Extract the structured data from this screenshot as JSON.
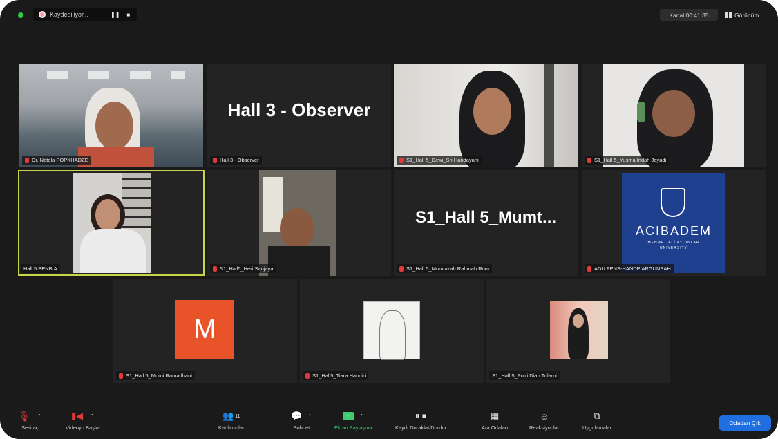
{
  "top_bar": {
    "recording_label": "Kaydediliyor...",
    "pause_icon": "❚❚",
    "stop_icon": "■",
    "timer_text": "Kanal 00:41:35",
    "view_label": "Görünüm"
  },
  "tiles": [
    {
      "name": "Dr. Natela POPKHADZE",
      "type": "video"
    },
    {
      "name": "Hall 3 - Observer",
      "type": "text",
      "display_text": "Hall 3 - Observer"
    },
    {
      "name": "S1_Hall 5_Dewi_Sri Handayani",
      "type": "video"
    },
    {
      "name": "S1_Hall 5_Yusma Indah Jayadi",
      "type": "video"
    },
    {
      "name": "Hall 5 BENBIA",
      "type": "video",
      "active": true
    },
    {
      "name": "S1_Hall5_Heri Sanjaya",
      "type": "video"
    },
    {
      "name": "S1_Hall 5_Mumtazah Rahmah Rum",
      "type": "text",
      "display_text": "S1_Hall 5_Mumt..."
    },
    {
      "name": "ADU FENS-HANDE ARGUNSAH",
      "type": "logo",
      "logo_text": "ACIBADEM",
      "logo_sub": "MEHMET ALİ AYDINLAR",
      "logo_sub2": "UNIVERSITY"
    },
    {
      "name": "S1_Hall 5_Murni Ramadhani",
      "type": "avatar",
      "avatar_letter": "M"
    },
    {
      "name": "S1_Hall5_Tiara Haudiri",
      "type": "video"
    },
    {
      "name": "S1_Hall 5_Putri Dian Trilami",
      "type": "video"
    }
  ],
  "toolbar": {
    "items": [
      {
        "label": "Sesi aç",
        "icon": "microphone-off"
      },
      {
        "label": "Videoyu Başlat",
        "icon": "camera-off"
      },
      {
        "label": "Katılımcılar",
        "icon": "participants",
        "count": "11"
      },
      {
        "label": "Sohbet",
        "icon": "chat"
      },
      {
        "label": "Ekran Paylaşma",
        "icon": "share-screen"
      },
      {
        "label": "Kaydı Duraklat/Durdur",
        "icon": "record-controls"
      },
      {
        "label": "Ara Odaları",
        "icon": "breakout-rooms"
      },
      {
        "label": "Reaksiyonlar",
        "icon": "reactions"
      },
      {
        "label": "Uygulamalar",
        "icon": "apps"
      }
    ],
    "leave_label": "Odadan Çık"
  },
  "colors": {
    "background": "#1a1a1a",
    "tile": "#232323",
    "active_border": "#c8d44a",
    "leave_button": "#1f6fe0",
    "share_green": "#3ad06b",
    "avatar_orange": "#e8532a",
    "logo_blue": "#1f3f8f"
  }
}
